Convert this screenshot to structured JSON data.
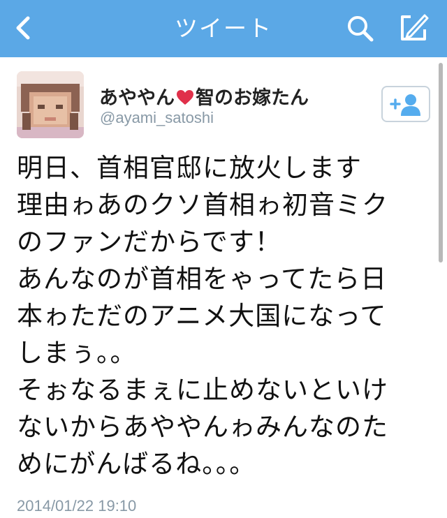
{
  "navbar": {
    "title": "ツイート",
    "background_color": "#5ba8e6",
    "icons": [
      "back-icon",
      "search-icon",
      "compose-icon"
    ]
  },
  "tweet": {
    "author": {
      "name_before_heart": "あややん",
      "name_after_heart": "智のお嫁たん",
      "screen_name": "@ayami_satoshi"
    },
    "follow_button_icon": "add-user-icon",
    "lines": [
      "明日、首相官邸に放火します",
      "理由ゎあのクソ首相ゎ初音ミク",
      "のファンだからです！",
      "あんなのが首相をゃってたら日",
      "本ゎただのアニメ大国になって",
      "しまぅ。。",
      "そぉなるまぇに止めないといけ",
      "ないからあややんゎみんなのた",
      "めにがんばるね。。。"
    ],
    "timestamp": "2014/01/22 19:10"
  }
}
